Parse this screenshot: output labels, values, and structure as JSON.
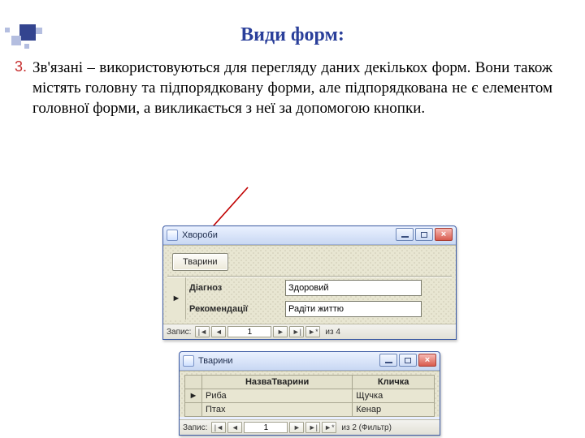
{
  "title": "Види форм:",
  "list_number": "3.",
  "paragraph": "Зв'язані – використовуються для перегляду даних декількох форм. Вони також містять головну та підпорядковану форми, але підпорядкована не є елементом головної форми, а викликається з неї за допомогою кнопки.",
  "main_window": {
    "title": "Хвороби",
    "open_button": "Тварини",
    "fields": {
      "diagnosis_label": "Діагноз",
      "diagnosis_value": "Здоровий",
      "recomm_label": "Рекомендації",
      "recomm_value": "Радіти життю"
    },
    "nav": {
      "label": "Запис:",
      "pos": "1",
      "of": "из  4"
    }
  },
  "sub_window": {
    "title": "Тварини",
    "columns": {
      "name": "НазваТварини",
      "nick": "Кличка"
    },
    "rows": [
      {
        "name": "Риба",
        "nick": "Щучка"
      },
      {
        "name": "Птах",
        "nick": "Кенар"
      }
    ],
    "nav": {
      "label": "Запис:",
      "pos": "1",
      "of": "из 2 (Фильтр)"
    }
  },
  "icons": {
    "first": "|◄",
    "prev": "◄",
    "next": "►",
    "last": "►|",
    "new": "►*",
    "rowmark": "►",
    "close": "×"
  }
}
